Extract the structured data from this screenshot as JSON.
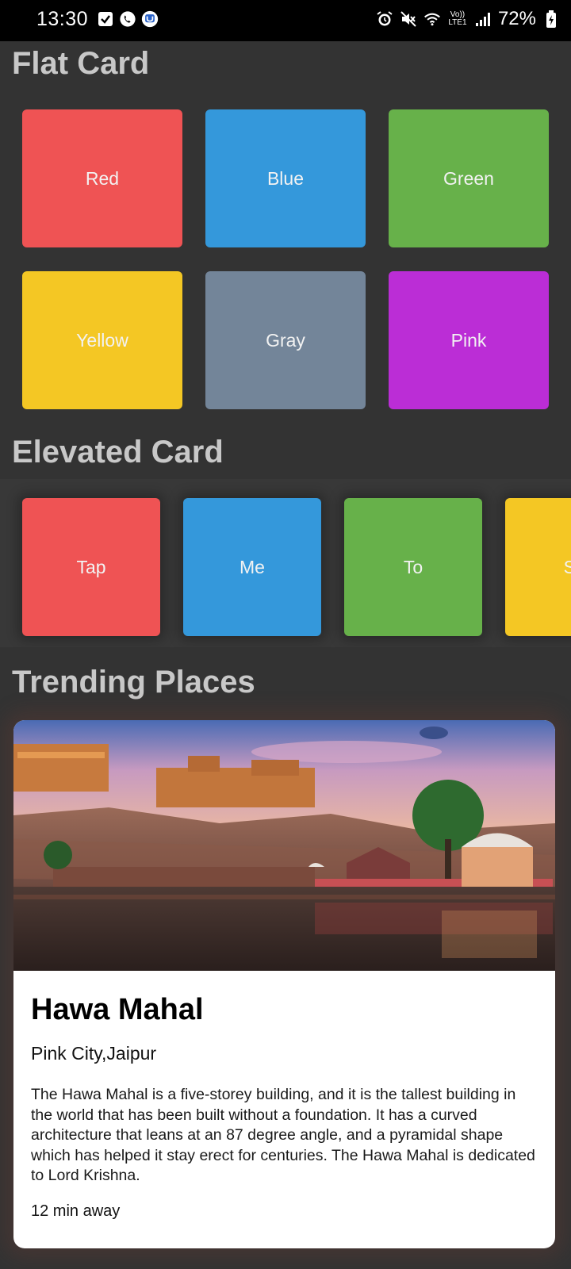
{
  "status_bar": {
    "time": "13:30",
    "network_label_top": "Vo))",
    "network_label_bottom": "LTE1",
    "battery": "72%"
  },
  "flat_section": {
    "title": "Flat Card",
    "cards": [
      {
        "label": "Red",
        "color": "#ef5354"
      },
      {
        "label": "Blue",
        "color": "#3498db"
      },
      {
        "label": "Green",
        "color": "#67b14a"
      },
      {
        "label": "Yellow",
        "color": "#f4c724"
      },
      {
        "label": "Gray",
        "color": "#738599"
      },
      {
        "label": "Pink",
        "color": "#bb2dd6"
      }
    ]
  },
  "elevated_section": {
    "title": "Elevated Card",
    "cards": [
      {
        "label": "Tap",
        "color": "#ef5354"
      },
      {
        "label": "Me",
        "color": "#3498db"
      },
      {
        "label": "To",
        "color": "#67b14a"
      },
      {
        "label": "Sc",
        "color": "#f4c724"
      }
    ]
  },
  "trending_section": {
    "title": "Trending Places",
    "place": {
      "name": "Hawa Mahal",
      "location": "Pink City,Jaipur",
      "description": "The Hawa Mahal is a five-storey building, and it is the tallest building in the world that has been built without a foundation. It has a curved architecture that leans at an 87 degree angle, and a pyramidal shape which has helped it stay erect for centuries. The Hawa Mahal is dedicated to Lord Krishna.",
      "travel_time": "12 min away"
    }
  }
}
